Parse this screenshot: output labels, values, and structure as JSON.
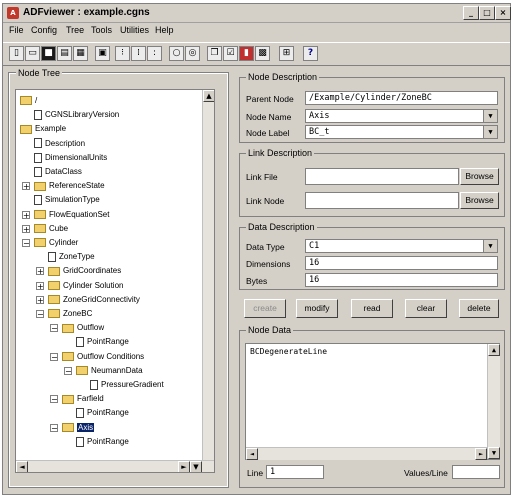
{
  "window": {
    "title": "ADFviewer : example.cgns",
    "minimize": "_",
    "maximize": "□",
    "close": "×"
  },
  "menu": [
    "File",
    "Config",
    "Tree",
    "Tools",
    "Utilities",
    "Help"
  ],
  "toolbar_icons": [
    "new-file-icon",
    "open-file-icon",
    "save-icon",
    "save-as-icon",
    "properties-icon",
    "view-icon",
    "tree-expand-icon",
    "tree-collapse-icon",
    "tree-level-icon",
    "find-icon",
    "find-next-icon",
    "copy-icon",
    "check-icon",
    "plot-icon",
    "grid-icon",
    "link-icon",
    "help-icon"
  ],
  "toolbar_help_glyph": "?",
  "node_tree": {
    "legend": "Node Tree",
    "nodes": [
      {
        "label": "/",
        "type": "folder",
        "expander": ""
      },
      {
        "label": "CGNSLibraryVersion",
        "type": "doc",
        "expander": ""
      },
      {
        "label": "Example",
        "type": "folder",
        "expander": "−"
      },
      {
        "label": "Description",
        "type": "doc",
        "expander": ""
      },
      {
        "label": "DimensionalUnits",
        "type": "doc",
        "expander": ""
      },
      {
        "label": "DataClass",
        "type": "doc",
        "expander": ""
      },
      {
        "label": "ReferenceState",
        "type": "folder",
        "expander": "+"
      },
      {
        "label": "SimulationType",
        "type": "doc",
        "expander": ""
      },
      {
        "label": "FlowEquationSet",
        "type": "folder",
        "expander": "+"
      },
      {
        "label": "Cube",
        "type": "folder",
        "expander": "+"
      },
      {
        "label": "Cylinder",
        "type": "folder",
        "expander": "−"
      },
      {
        "label": "ZoneType",
        "type": "doc",
        "expander": ""
      },
      {
        "label": "GridCoordinates",
        "type": "folder",
        "expander": "+"
      },
      {
        "label": "Cylinder Solution",
        "type": "folder",
        "expander": "+"
      },
      {
        "label": "ZoneGridConnectivity",
        "type": "folder",
        "expander": "+"
      },
      {
        "label": "ZoneBC",
        "type": "folder",
        "expander": "−"
      },
      {
        "label": "Outflow",
        "type": "folder",
        "expander": "−"
      },
      {
        "label": "PointRange",
        "type": "doc",
        "expander": ""
      },
      {
        "label": "Outflow Conditions",
        "type": "folder",
        "expander": "−"
      },
      {
        "label": "NeumannData",
        "type": "folder",
        "expander": "−"
      },
      {
        "label": "PressureGradient",
        "type": "doc",
        "expander": ""
      },
      {
        "label": "Farfield",
        "type": "folder",
        "expander": "−"
      },
      {
        "label": "PointRange",
        "type": "doc",
        "expander": ""
      },
      {
        "label": "Axis",
        "type": "folder",
        "expander": "−",
        "selected": true
      },
      {
        "label": "PointRange",
        "type": "doc",
        "expander": ""
      }
    ]
  },
  "node_description": {
    "legend": "Node Description",
    "parent_node_label": "Parent Node",
    "parent_node_value": "/Example/Cylinder/ZoneBC",
    "node_name_label": "Node Name",
    "node_name_value": "Axis",
    "node_label_label": "Node Label",
    "node_label_value": "BC_t"
  },
  "link_description": {
    "legend": "Link Description",
    "link_file_label": "Link File",
    "link_file_value": "",
    "link_node_label": "Link Node",
    "link_node_value": "",
    "browse_label": "Browse"
  },
  "data_description": {
    "legend": "Data Description",
    "data_type_label": "Data Type",
    "data_type_value": "C1",
    "dimensions_label": "Dimensions",
    "dimensions_value": "16",
    "bytes_label": "Bytes",
    "bytes_value": "16"
  },
  "actions": {
    "create": "create",
    "modify": "modify",
    "read": "read",
    "clear": "clear",
    "delete": "delete"
  },
  "node_data": {
    "legend": "Node Data",
    "content": "BCDegenerateLine",
    "line_label": "Line",
    "line_value": "1",
    "values_per_line_label": "Values/Line",
    "values_per_line_value": ""
  },
  "scroll_glyphs": {
    "up": "▲",
    "down": "▼",
    "left": "◄",
    "right": "►"
  }
}
